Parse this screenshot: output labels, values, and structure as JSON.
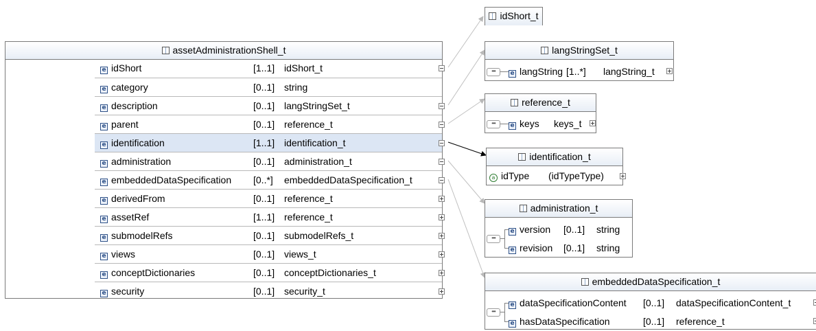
{
  "main": {
    "title": "assetAdministrationShell_t",
    "rows": [
      {
        "name": "idShort",
        "card": "[1..1]",
        "type": "idShort_t",
        "expander": "minus"
      },
      {
        "name": "category",
        "card": "[0..1]",
        "type": "string",
        "expander": "none"
      },
      {
        "name": "description",
        "card": "[0..1]",
        "type": "langStringSet_t",
        "expander": "minus"
      },
      {
        "name": "parent",
        "card": "[0..1]",
        "type": "reference_t",
        "expander": "minus"
      },
      {
        "name": "identification",
        "card": "[1..1]",
        "type": "identification_t",
        "expander": "minus",
        "selected": true
      },
      {
        "name": "administration",
        "card": "[0..1]",
        "type": "administration_t",
        "expander": "minus"
      },
      {
        "name": "embeddedDataSpecification",
        "card": "[0..*]",
        "type": "embeddedDataSpecification_t",
        "expander": "minus"
      },
      {
        "name": "derivedFrom",
        "card": "[0..1]",
        "type": "reference_t",
        "expander": "plus"
      },
      {
        "name": "assetRef",
        "card": "[1..1]",
        "type": "reference_t",
        "expander": "plus"
      },
      {
        "name": "submodelRefs",
        "card": "[0..1]",
        "type": "submodelRefs_t",
        "expander": "plus"
      },
      {
        "name": "views",
        "card": "[0..1]",
        "type": "views_t",
        "expander": "plus"
      },
      {
        "name": "conceptDictionaries",
        "card": "[0..1]",
        "type": "conceptDictionaries_t",
        "expander": "plus"
      },
      {
        "name": "security",
        "card": "[0..1]",
        "type": "security_t",
        "expander": "plus"
      }
    ]
  },
  "types": {
    "idShort": {
      "title": "idShort_t"
    },
    "langStringSet": {
      "title": "langStringSet_t",
      "row": {
        "name": "langString",
        "card": "[1..*]",
        "type": "langString_t"
      }
    },
    "reference": {
      "title": "reference_t",
      "row": {
        "name": "keys",
        "type": "keys_t"
      }
    },
    "identification": {
      "title": "identification_t",
      "row": {
        "name": "idType",
        "type": "(idTypeType)"
      }
    },
    "administration": {
      "title": "administration_t",
      "rows": [
        {
          "name": "version",
          "card": "[0..1]",
          "type": "string"
        },
        {
          "name": "revision",
          "card": "[0..1]",
          "type": "string"
        }
      ]
    },
    "embeddedDataSpecification": {
      "title": "embeddedDataSpecification_t",
      "rows": [
        {
          "name": "dataSpecificationContent",
          "card": "[0..1]",
          "type": "dataSpecificationContent_t"
        },
        {
          "name": "hasDataSpecification",
          "card": "[0..1]",
          "type": "reference_t"
        }
      ]
    }
  },
  "icons": {
    "element": "e",
    "attribute": "a",
    "sequence": "•••"
  },
  "colors": {
    "selected_row": "#dce6f4",
    "border": "#7a7a7a",
    "element_icon": "#2c4f86",
    "attribute_icon": "#2f7d32"
  }
}
